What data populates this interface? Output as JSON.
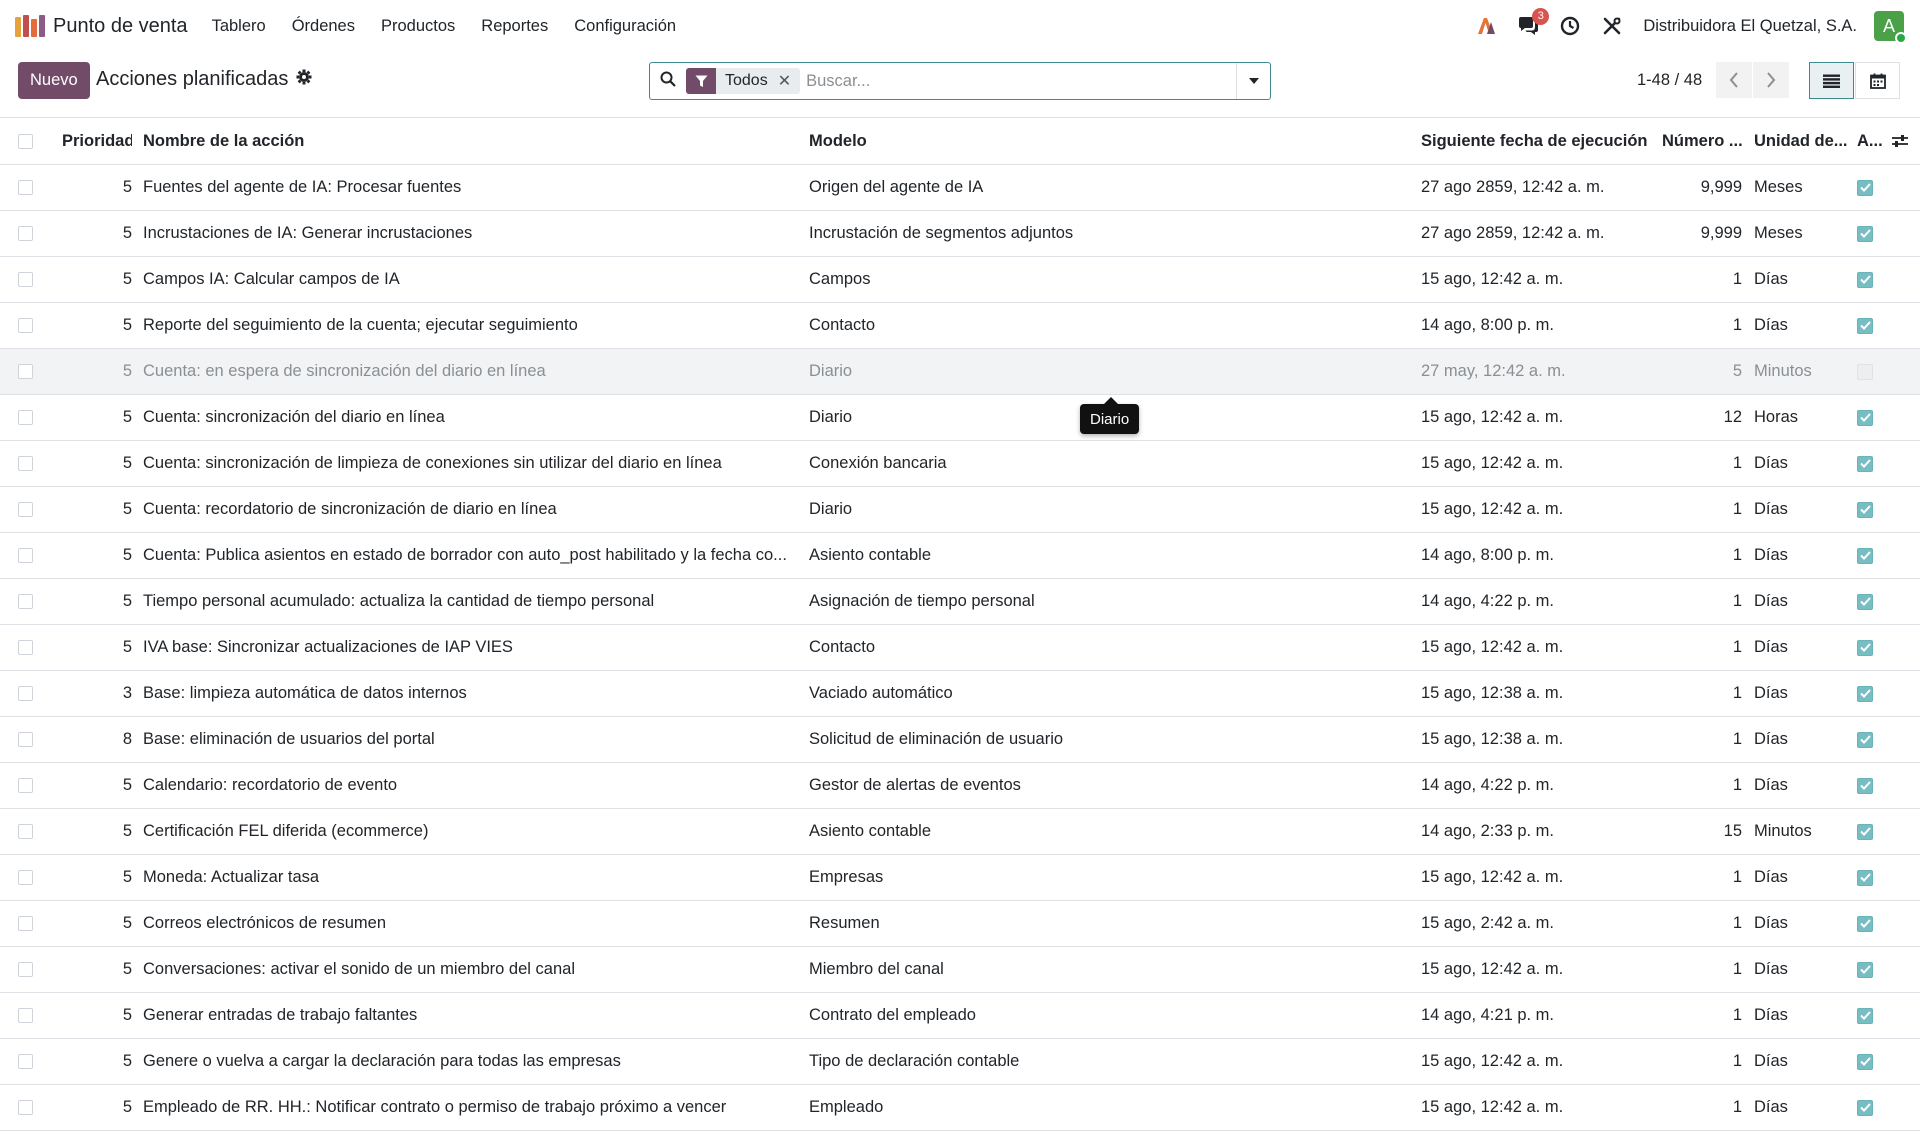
{
  "navbar": {
    "brand": "Punto de venta",
    "menu": [
      "Tablero",
      "Órdenes",
      "Productos",
      "Reportes",
      "Configuración"
    ],
    "messages_badge": "3",
    "company": "Distribuidora El Quetzal, S.A.",
    "avatar_initial": "A"
  },
  "control": {
    "new_button": "Nuevo",
    "title": "Acciones planificadas",
    "facet_label": "Todos",
    "search_placeholder": "Buscar...",
    "pager": "1-48 / 48"
  },
  "table": {
    "headers": {
      "priority": "Prioridad",
      "name": "Nombre de la acción",
      "model": "Modelo",
      "next": "Siguiente fecha de ejecución",
      "number": "Número ...",
      "unit": "Unidad de...",
      "active": "A..."
    },
    "rows": [
      {
        "priority": "5",
        "name": "Fuentes del agente de IA: Procesar fuentes",
        "model": "Origen del agente de IA",
        "next": "27 ago 2859, 12:42 a. m.",
        "number": "9,999",
        "unit": "Meses",
        "active": true
      },
      {
        "priority": "5",
        "name": "Incrustaciones de IA: Generar incrustaciones",
        "model": "Incrustación de segmentos adjuntos",
        "next": "27 ago 2859, 12:42 a. m.",
        "number": "9,999",
        "unit": "Meses",
        "active": true
      },
      {
        "priority": "5",
        "name": "Campos IA: Calcular campos de IA",
        "model": "Campos",
        "next": "15 ago, 12:42 a. m.",
        "number": "1",
        "unit": "Días",
        "active": true
      },
      {
        "priority": "5",
        "name": "Reporte del seguimiento de la cuenta; ejecutar seguimiento",
        "model": "Contacto",
        "next": "14 ago, 8:00 p. m.",
        "number": "1",
        "unit": "Días",
        "active": true
      },
      {
        "priority": "5",
        "name": "Cuenta: en espera de sincronización del diario en línea",
        "model": "Diario",
        "next": "27 may, 12:42 a. m.",
        "number": "5",
        "unit": "Minutos",
        "active": false
      },
      {
        "priority": "5",
        "name": "Cuenta: sincronización del diario en línea",
        "model": "Diario",
        "next": "15 ago, 12:42 a. m.",
        "number": "12",
        "unit": "Horas",
        "active": true
      },
      {
        "priority": "5",
        "name": "Cuenta: sincronización de limpieza de conexiones sin utilizar del diario en línea",
        "model": "Conexión bancaria",
        "next": "15 ago, 12:42 a. m.",
        "number": "1",
        "unit": "Días",
        "active": true
      },
      {
        "priority": "5",
        "name": "Cuenta: recordatorio de sincronización de diario en línea",
        "model": "Diario",
        "next": "15 ago, 12:42 a. m.",
        "number": "1",
        "unit": "Días",
        "active": true
      },
      {
        "priority": "5",
        "name": "Cuenta: Publica asientos en estado de borrador con auto_post habilitado y la fecha co...",
        "model": "Asiento contable",
        "next": "14 ago, 8:00 p. m.",
        "number": "1",
        "unit": "Días",
        "active": true
      },
      {
        "priority": "5",
        "name": "Tiempo personal acumulado: actualiza la cantidad de tiempo personal",
        "model": "Asignación de tiempo personal",
        "next": "14 ago, 4:22 p. m.",
        "number": "1",
        "unit": "Días",
        "active": true
      },
      {
        "priority": "5",
        "name": "IVA base: Sincronizar actualizaciones de IAP VIES",
        "model": "Contacto",
        "next": "15 ago, 12:42 a. m.",
        "number": "1",
        "unit": "Días",
        "active": true
      },
      {
        "priority": "3",
        "name": "Base: limpieza automática de datos internos",
        "model": "Vaciado automático",
        "next": "15 ago, 12:38 a. m.",
        "number": "1",
        "unit": "Días",
        "active": true
      },
      {
        "priority": "8",
        "name": "Base: eliminación de usuarios del portal",
        "model": "Solicitud de eliminación de usuario",
        "next": "15 ago, 12:38 a. m.",
        "number": "1",
        "unit": "Días",
        "active": true
      },
      {
        "priority": "5",
        "name": "Calendario: recordatorio de evento",
        "model": "Gestor de alertas de eventos",
        "next": "14 ago, 4:22 p. m.",
        "number": "1",
        "unit": "Días",
        "active": true
      },
      {
        "priority": "5",
        "name": "Certificación FEL diferida (ecommerce)",
        "model": "Asiento contable",
        "next": "14 ago, 2:33 p. m.",
        "number": "15",
        "unit": "Minutos",
        "active": true
      },
      {
        "priority": "5",
        "name": "Moneda: Actualizar tasa",
        "model": "Empresas",
        "next": "15 ago, 12:42 a. m.",
        "number": "1",
        "unit": "Días",
        "active": true
      },
      {
        "priority": "5",
        "name": "Correos electrónicos de resumen",
        "model": "Resumen",
        "next": "15 ago, 2:42 a. m.",
        "number": "1",
        "unit": "Días",
        "active": true
      },
      {
        "priority": "5",
        "name": "Conversaciones: activar el sonido de un miembro del canal",
        "model": "Miembro del canal",
        "next": "15 ago, 12:42 a. m.",
        "number": "1",
        "unit": "Días",
        "active": true
      },
      {
        "priority": "5",
        "name": "Generar entradas de trabajo faltantes",
        "model": "Contrato del empleado",
        "next": "14 ago, 4:21 p. m.",
        "number": "1",
        "unit": "Días",
        "active": true
      },
      {
        "priority": "5",
        "name": "Genere o vuelva a cargar la declaración para todas las empresas",
        "model": "Tipo de declaración contable",
        "next": "15 ago, 12:42 a. m.",
        "number": "1",
        "unit": "Días",
        "active": true
      },
      {
        "priority": "5",
        "name": "Empleado de RR. HH.: Notificar contrato o permiso de trabajo próximo a vencer",
        "model": "Empleado",
        "next": "15 ago, 12:42 a. m.",
        "number": "1",
        "unit": "Días",
        "active": true
      }
    ]
  },
  "tooltip": "Diario",
  "colors": {
    "brand": "#714b67",
    "accent": "#3f8a8f",
    "checkbox_on": "#76bec3"
  }
}
